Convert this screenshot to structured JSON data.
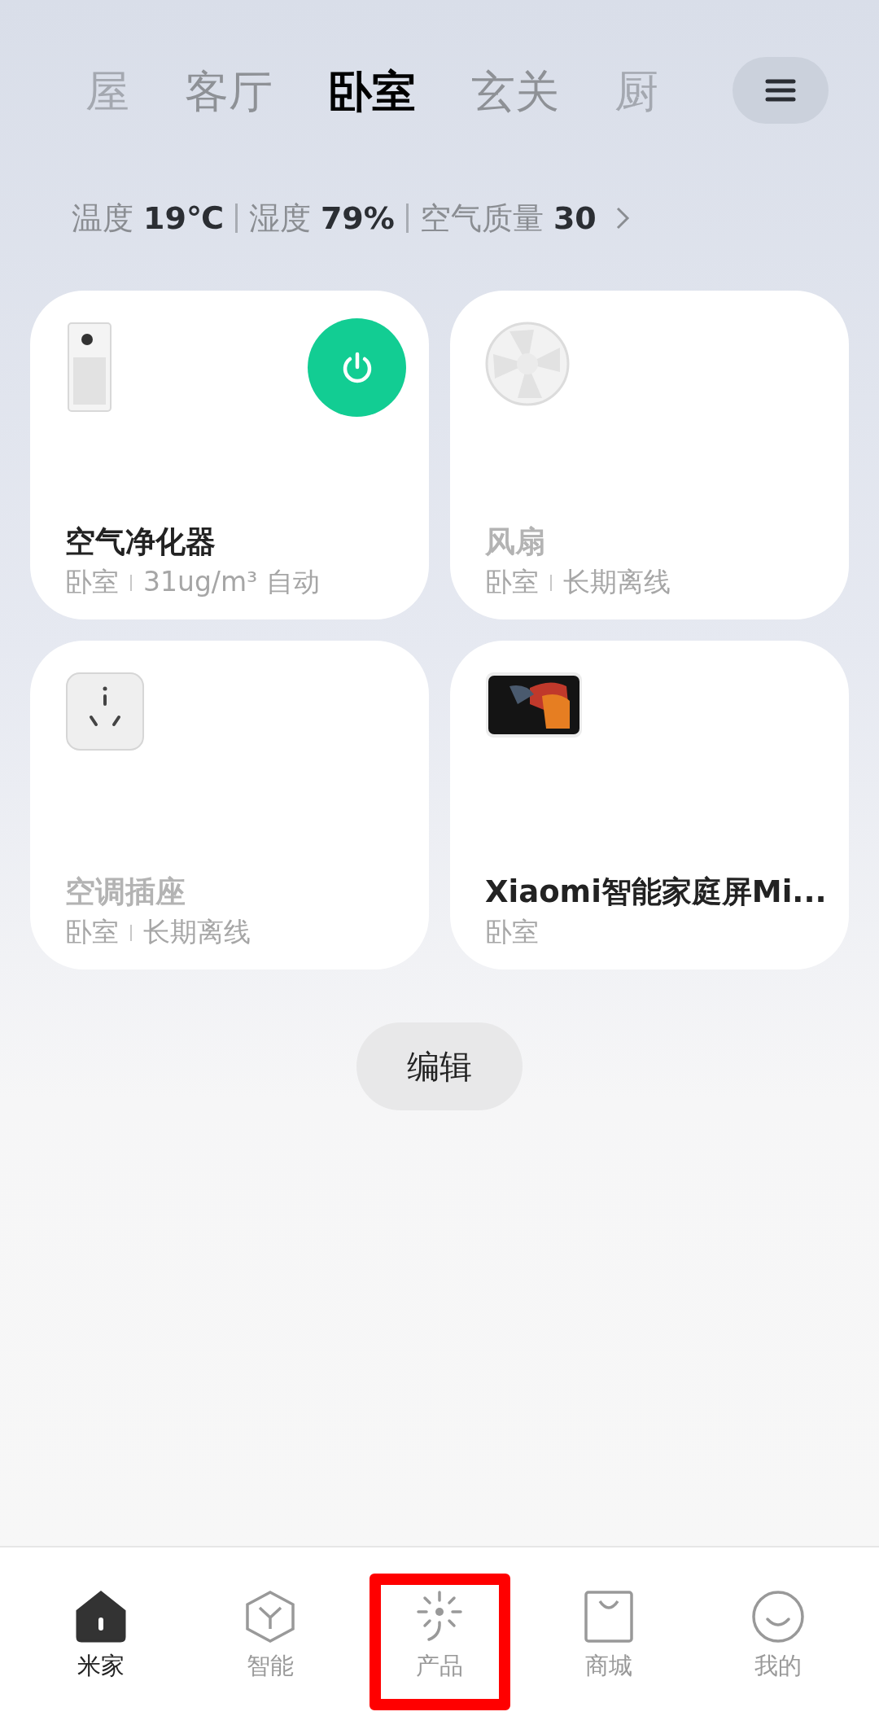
{
  "room_tabs": [
    {
      "label": "屋",
      "selected": false,
      "faded": true
    },
    {
      "label": "客厅",
      "selected": false,
      "faded": false
    },
    {
      "label": "卧室",
      "selected": true,
      "faded": false
    },
    {
      "label": "玄关",
      "selected": false,
      "faded": false
    },
    {
      "label": "厨",
      "selected": false,
      "faded": true
    }
  ],
  "environment": [
    {
      "label": "温度",
      "value": "19℃"
    },
    {
      "label": "湿度",
      "value": "79%"
    },
    {
      "label": "空气质量",
      "value": "30"
    }
  ],
  "devices": [
    {
      "kind": "purifier",
      "name": "空气净化器",
      "room": "卧室",
      "detail": "31ug/m³ 自动",
      "online": true,
      "power_button": true
    },
    {
      "kind": "fan",
      "name": "风扇",
      "room": "卧室",
      "detail": "长期离线",
      "online": false,
      "power_button": false
    },
    {
      "kind": "plug",
      "name": "空调插座",
      "room": "卧室",
      "detail": "长期离线",
      "online": false,
      "power_button": false
    },
    {
      "kind": "display",
      "name": "Xiaomi智能家庭屏Mi...",
      "room": "卧室",
      "online": true,
      "power_button": false
    }
  ],
  "edit_button": "编辑",
  "bottom_nav": [
    {
      "kind": "home",
      "label": "米家",
      "selected": true,
      "highlighted": false
    },
    {
      "kind": "hexagon",
      "label": "智能",
      "selected": false,
      "highlighted": false
    },
    {
      "kind": "sparkle",
      "label": "产品",
      "selected": false,
      "highlighted": true
    },
    {
      "kind": "bag",
      "label": "商城",
      "selected": false,
      "highlighted": false
    },
    {
      "kind": "smile",
      "label": "我的",
      "selected": false,
      "highlighted": false
    }
  ]
}
